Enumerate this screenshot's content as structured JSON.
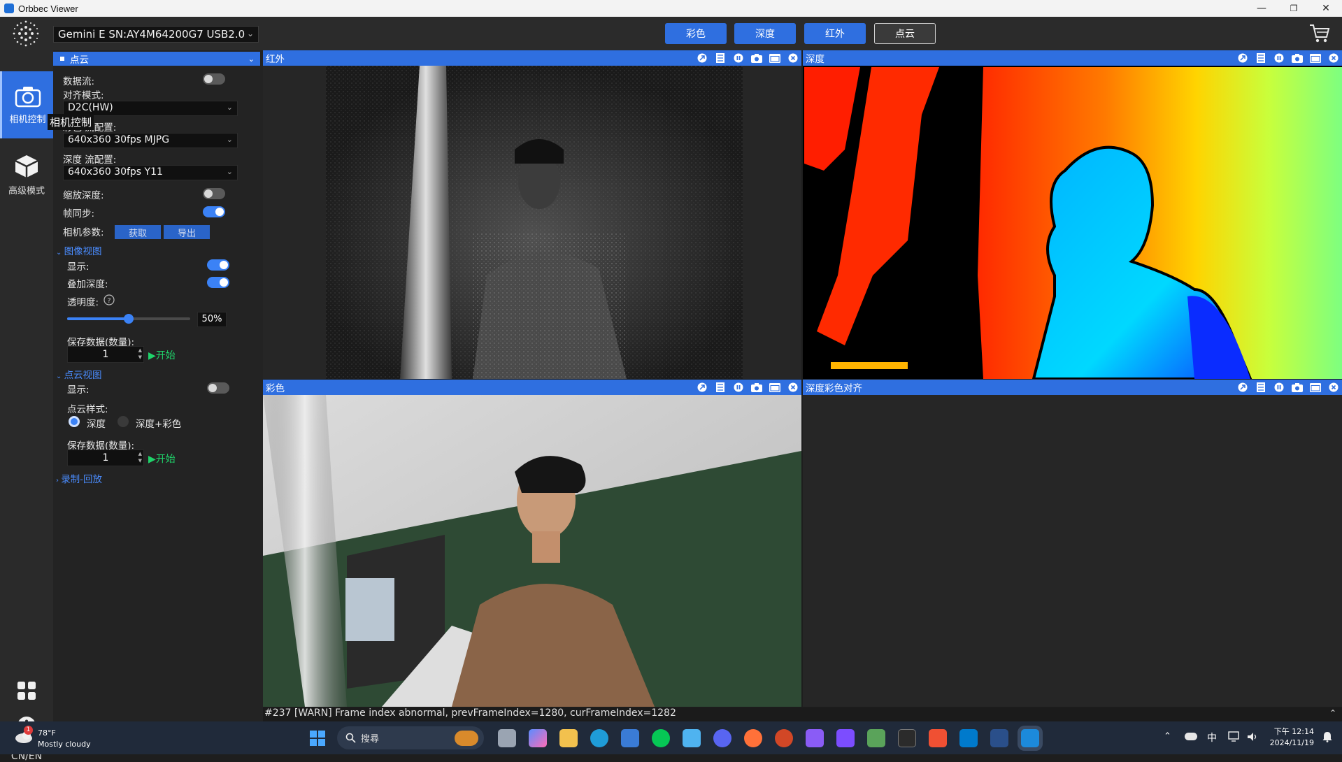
{
  "window": {
    "title": "Orbbec Viewer",
    "controls": [
      "—",
      "❐",
      "✕"
    ]
  },
  "toolbar": {
    "device": "Gemini E SN:AY4M64200G7 USB2.0",
    "modes": [
      {
        "label": "彩色",
        "active": false
      },
      {
        "label": "深度",
        "active": false
      },
      {
        "label": "红外",
        "active": false
      },
      {
        "label": "点云",
        "active": true
      }
    ]
  },
  "rail": {
    "items": [
      {
        "label": "相机控制",
        "icon": "camera-icon",
        "active": true
      },
      {
        "label": "高级模式",
        "icon": "cube-icon",
        "active": false
      }
    ],
    "tooltip": "相机控制",
    "lang": "CN/EN"
  },
  "panel": {
    "header": "点云",
    "data_stream_label": "数据流:",
    "align_mode_label": "对齐模式:",
    "align_mode_value": "D2C(HW)",
    "color_config_label": "彩色 流配置:",
    "color_config_value": "640x360 30fps MJPG",
    "depth_config_label": "深度 流配置:",
    "depth_config_value": "640x360 30fps Y11",
    "scale_depth_label": "缩放深度:",
    "frame_sync_label": "帧同步:",
    "camera_params_label": "相机参数:",
    "fetch_btn": "获取",
    "export_btn": "导出",
    "image_view_section": "图像视图",
    "display_label": "显示:",
    "overlay_depth_label": "叠加深度:",
    "transparency_label": "透明度:",
    "transparency_value": "50%",
    "transparency_fraction": 0.5,
    "save_count_label": "保存数据(数量):",
    "save_count_value": "1",
    "start_label": "开始",
    "pointcloud_section": "点云视图",
    "pc_display_label": "显示:",
    "pc_style_label": "点云样式:",
    "pc_style_options": [
      "深度",
      "深度+彩色"
    ],
    "pc_save_count_label": "保存数据(数量):",
    "pc_save_count_value": "1",
    "pc_start_label": "开始",
    "record_section": "录制-回放",
    "toggles": {
      "data_stream": false,
      "scale_depth": false,
      "frame_sync": true,
      "display": true,
      "overlay_depth": true,
      "pc_display": false
    }
  },
  "panes": {
    "ir": "红外",
    "depth": "深度",
    "color": "彩色",
    "aligned": "深度彩色对齐"
  },
  "log": "#237 [WARN] Frame index abnormal, prevFrameIndex=1280, curFrameIndex=1282",
  "taskbar": {
    "weather_temp": "78°F",
    "weather_desc": "Mostly cloudy",
    "weather_badge": "1",
    "search_placeholder": "搜尋",
    "ime": "中",
    "time": "下午 12:14",
    "date": "2024/11/19"
  },
  "colors": {
    "accent": "#2f6fe0",
    "toggle_on": "#3b82f6",
    "start_green": "#1fd36a"
  }
}
